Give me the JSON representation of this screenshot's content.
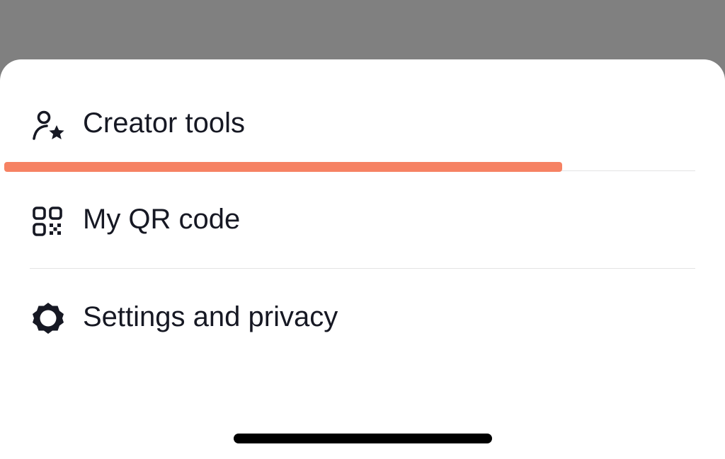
{
  "menu": {
    "items": [
      {
        "label": "Creator tools",
        "icon": "creator-star-icon"
      },
      {
        "label": "My QR code",
        "icon": "qr-code-icon"
      },
      {
        "label": "Settings and privacy",
        "icon": "gear-icon"
      }
    ]
  },
  "colors": {
    "overlay": "#808080",
    "sheet": "#ffffff",
    "text": "#161823",
    "divider": "#e3e3e4",
    "highlight": "#f68263",
    "home_indicator": "#000000"
  }
}
